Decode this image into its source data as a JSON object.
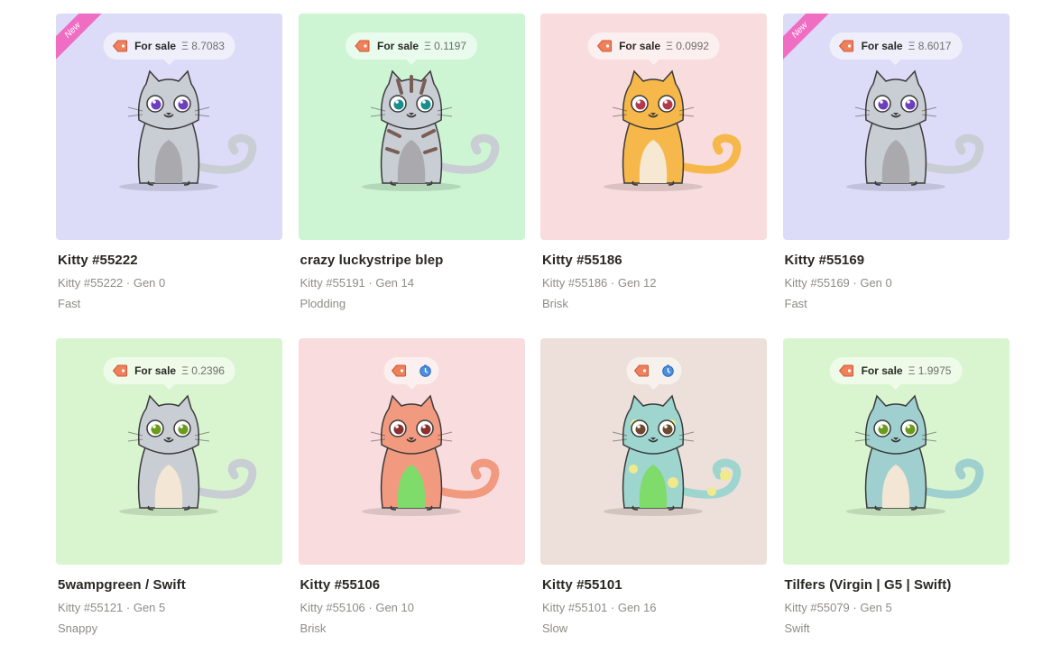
{
  "kitties": [
    {
      "name": "Kitty #55222",
      "sub": "Kitty #55222 · Gen 0",
      "speed": "Fast",
      "new": true,
      "newLabel": "New",
      "bg": "#dcdcf8",
      "saleLabel": "For sale",
      "price": "Ξ 8.7083",
      "showSale": true,
      "showClock": false,
      "body": "#c9cdd4",
      "belly": "#aaa9ae",
      "eye": "#6c3fbf",
      "pattern": "none",
      "patternColor": "#000000"
    },
    {
      "name": "crazy luckystripe blep",
      "sub": "Kitty #55191 · Gen 14",
      "speed": "Plodding",
      "new": false,
      "newLabel": "",
      "bg": "#cdf5d4",
      "saleLabel": "For sale",
      "price": "Ξ 0.1197",
      "showSale": true,
      "showClock": false,
      "body": "#c9cdd4",
      "belly": "#aaa9ae",
      "eye": "#1a8e8e",
      "pattern": "stripe",
      "patternColor": "#7a5e55"
    },
    {
      "name": "Kitty #55186",
      "sub": "Kitty #55186 · Gen 12",
      "speed": "Brisk",
      "new": false,
      "newLabel": "",
      "bg": "#f9dcdd",
      "saleLabel": "For sale",
      "price": "Ξ 0.0992",
      "showSale": true,
      "showClock": false,
      "body": "#f6b84a",
      "belly": "#f6e8d2",
      "eye": "#b23a4a",
      "pattern": "none",
      "patternColor": "#000000"
    },
    {
      "name": "Kitty #55169",
      "sub": "Kitty #55169 · Gen 0",
      "speed": "Fast",
      "new": true,
      "newLabel": "New",
      "bg": "#dcdcf8",
      "saleLabel": "For sale",
      "price": "Ξ 8.6017",
      "showSale": true,
      "showClock": false,
      "body": "#c9cdd4",
      "belly": "#aaa9ae",
      "eye": "#6c3fbf",
      "pattern": "none",
      "patternColor": "#000000"
    },
    {
      "name": "5wampgreen / Swift",
      "sub": "Kitty #55121 · Gen 5",
      "speed": "Snappy",
      "new": false,
      "newLabel": "",
      "bg": "#d9f5cf",
      "saleLabel": "For sale",
      "price": "Ξ 0.2396",
      "showSale": true,
      "showClock": false,
      "body": "#c9cdd4",
      "belly": "#f3e6d4",
      "eye": "#6b9b1c",
      "pattern": "none",
      "patternColor": "#000000"
    },
    {
      "name": "Kitty #55106",
      "sub": "Kitty #55106 · Gen 10",
      "speed": "Brisk",
      "new": false,
      "newLabel": "",
      "bg": "#f9dcdd",
      "saleLabel": "",
      "price": "",
      "showSale": false,
      "showClock": true,
      "body": "#f19a80",
      "belly": "#7fdb6a",
      "eye": "#8a3030",
      "pattern": "none",
      "patternColor": "#000000"
    },
    {
      "name": "Kitty #55101",
      "sub": "Kitty #55101 · Gen 16",
      "speed": "Slow",
      "new": false,
      "newLabel": "",
      "bg": "#ede0da",
      "saleLabel": "",
      "price": "",
      "showSale": false,
      "showClock": true,
      "body": "#9ed6cf",
      "belly": "#7fdb6a",
      "eye": "#6b4a30",
      "pattern": "spots",
      "patternColor": "#f2e98a"
    },
    {
      "name": "Tilfers (Virgin | G5 | Swift)",
      "sub": "Kitty #55079 · Gen 5",
      "speed": "Swift",
      "new": false,
      "newLabel": "",
      "bg": "#d9f5cf",
      "saleLabel": "For sale",
      "price": "Ξ 1.9975",
      "showSale": true,
      "showClock": false,
      "body": "#9fcfce",
      "belly": "#f3e6d4",
      "eye": "#6b9b1c",
      "pattern": "none",
      "patternColor": "#000000"
    }
  ]
}
